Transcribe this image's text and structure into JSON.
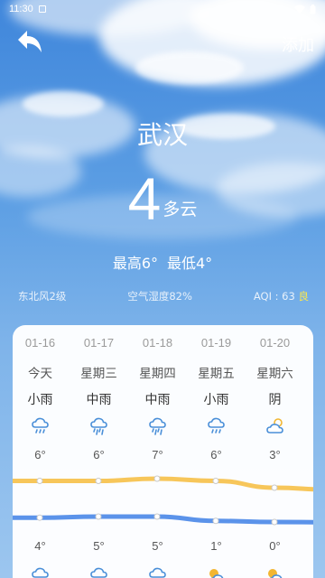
{
  "status_bar": {
    "time": "11:30"
  },
  "header": {
    "add_label": "添加"
  },
  "current": {
    "city": "武汉",
    "temperature": "4",
    "condition": "多云",
    "high": "最高6°",
    "low": "最低4°",
    "wind": "东北风2级",
    "humidity": "空气湿度82%",
    "aqi_label": "AQI : 63",
    "aqi_level": "良"
  },
  "colors": {
    "high_line": "#f7c65a",
    "low_line": "#5b93ea",
    "aqi_level": "#ffe94a"
  },
  "forecast": [
    {
      "date": "01-16",
      "day": "今天",
      "weather": "小雨",
      "icon": "light-rain-icon",
      "high": "6°",
      "high_value": 6,
      "low": "4°",
      "low_value": 4,
      "night_icon": "rain-icon"
    },
    {
      "date": "01-17",
      "day": "星期三",
      "weather": "中雨",
      "icon": "moderate-rain-icon",
      "high": "6°",
      "high_value": 6,
      "low": "5°",
      "low_value": 5,
      "night_icon": "rain-icon"
    },
    {
      "date": "01-18",
      "day": "星期四",
      "weather": "中雨",
      "icon": "moderate-rain-icon",
      "high": "7°",
      "high_value": 7,
      "low": "5°",
      "low_value": 5,
      "night_icon": "rain-icon"
    },
    {
      "date": "01-19",
      "day": "星期五",
      "weather": "小雨",
      "icon": "light-rain-icon",
      "high": "6°",
      "high_value": 6,
      "low": "1°",
      "low_value": 1,
      "night_icon": "partly-cloudy-icon"
    },
    {
      "date": "01-20",
      "day": "星期六",
      "weather": "阴",
      "icon": "overcast-icon",
      "high": "3°",
      "high_value": 3,
      "low": "0°",
      "low_value": 0,
      "night_icon": "partly-cloudy-icon"
    }
  ]
}
